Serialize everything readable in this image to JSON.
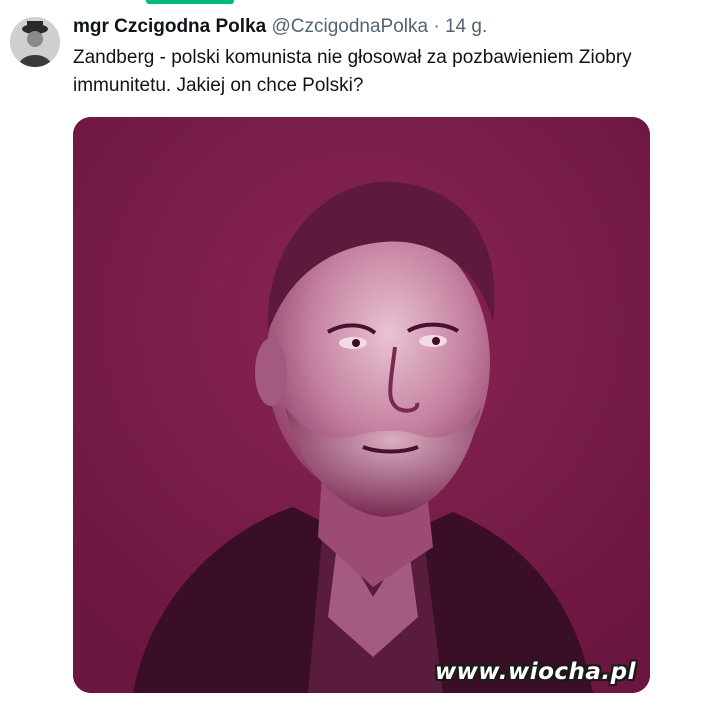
{
  "tweet": {
    "author": {
      "display_name": "mgr Czcigodna Polka",
      "handle": "@CzcigodnaPolka"
    },
    "separator": "·",
    "timestamp": "14 g.",
    "text": "Zandberg - polski komunista nie głosował za pozbawieniem Ziobry immunitetu. Jakiej on chce Polski?",
    "media": {
      "type": "photo",
      "tint_color": "#7d1d4b"
    }
  },
  "watermark": "www.wiocha.pl",
  "colors": {
    "accent_tab": "#00ba7c",
    "text_primary": "#0f1419",
    "text_secondary": "#536471"
  }
}
